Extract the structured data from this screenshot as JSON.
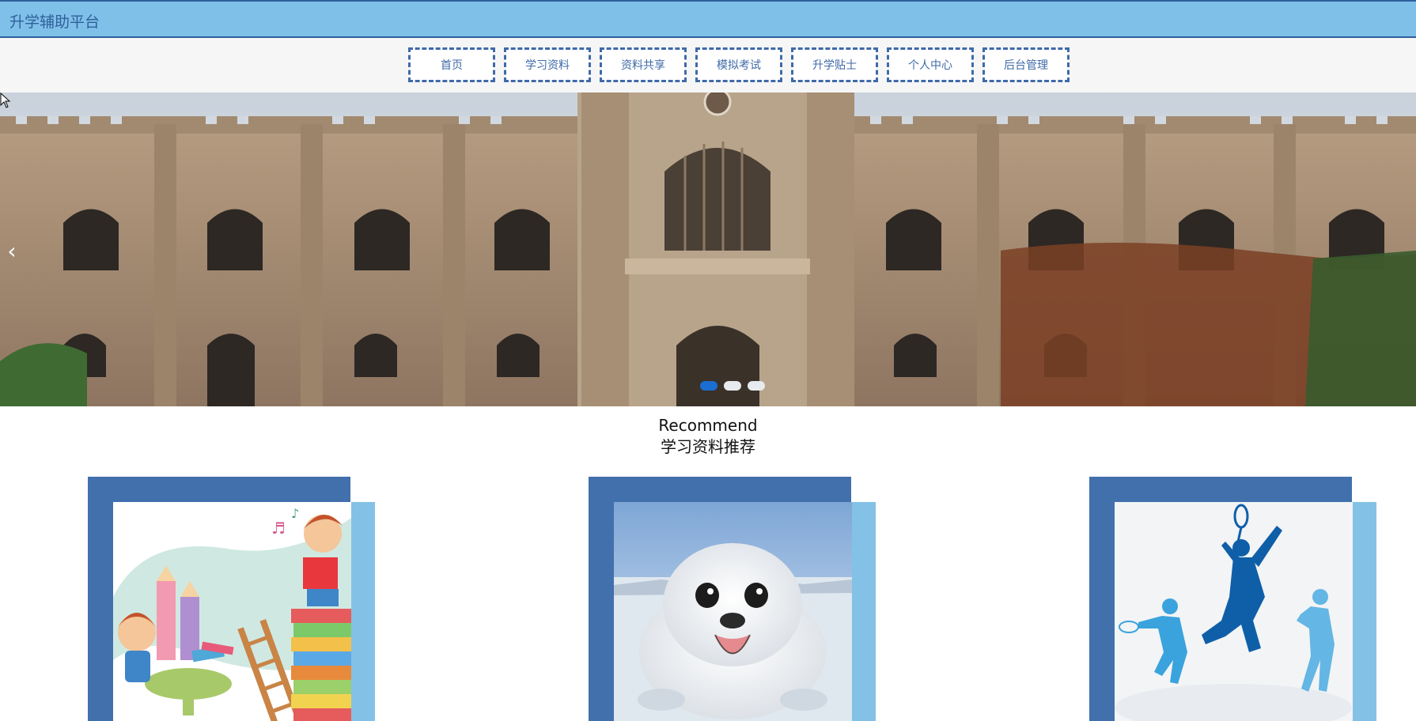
{
  "app": {
    "title": "升学辅助平台"
  },
  "nav": {
    "items": [
      {
        "label": "首页"
      },
      {
        "label": "学习资料"
      },
      {
        "label": "资料共享"
      },
      {
        "label": "模拟考试"
      },
      {
        "label": "升学贴士"
      },
      {
        "label": "个人中心"
      },
      {
        "label": "后台管理"
      }
    ]
  },
  "carousel": {
    "slide_count": 3,
    "active_index": 0,
    "prev_icon": "chevron-left-icon"
  },
  "recommend": {
    "title_en": "Recommend",
    "title_cn": "学习资料推荐"
  },
  "cards": [
    {
      "image": "children-reading-illustration"
    },
    {
      "image": "baby-seal-photo"
    },
    {
      "image": "sports-silhouettes"
    }
  ],
  "colors": {
    "header_bg": "#7fc0e8",
    "brand_blue": "#3f6aa8",
    "card_dark": "#4170ad",
    "card_light": "#84c1e7",
    "dot_active": "#1b6ed1"
  }
}
